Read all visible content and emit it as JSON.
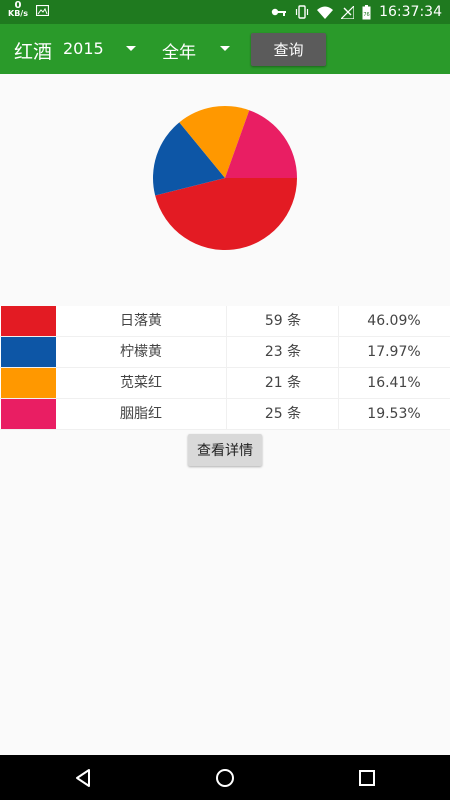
{
  "status_bar": {
    "net_speed_value": "0",
    "net_speed_unit": "KB/s",
    "time": "16:37:34",
    "icons": [
      "image-icon",
      "key-icon",
      "vibrate-icon",
      "wifi-icon",
      "signal-off-icon",
      "battery-icon"
    ]
  },
  "toolbar": {
    "title": "红酒",
    "year": "2015",
    "period": "全年",
    "query_label": "查询",
    "background": "#2a9a2a"
  },
  "chart_data": {
    "type": "pie",
    "slices": [
      {
        "label": "日落黄",
        "count": 59,
        "percent": 46.09,
        "color": "#e31b23"
      },
      {
        "label": "柠檬黄",
        "count": 23,
        "percent": 17.97,
        "color": "#0d56a6"
      },
      {
        "label": "苋菜红",
        "count": 21,
        "percent": 16.41,
        "color": "#ff9800"
      },
      {
        "label": "胭脂红",
        "count": 25,
        "percent": 19.53,
        "color": "#e91e63"
      }
    ]
  },
  "legend": {
    "unit": "条",
    "rows": [
      {
        "name": "日落黄",
        "count": "59 条",
        "percent": "46.09%",
        "color": "#e31b23"
      },
      {
        "name": "柠檬黄",
        "count": "23 条",
        "percent": "17.97%",
        "color": "#0d56a6"
      },
      {
        "name": "苋菜红",
        "count": "21 条",
        "percent": "16.41%",
        "color": "#ff9800"
      },
      {
        "name": "胭脂红",
        "count": "25 条",
        "percent": "19.53%",
        "color": "#e91e63"
      }
    ]
  },
  "detail_button_label": "查看详情",
  "nav_bar": {
    "icons": [
      "back-icon",
      "home-icon",
      "recents-icon"
    ]
  }
}
